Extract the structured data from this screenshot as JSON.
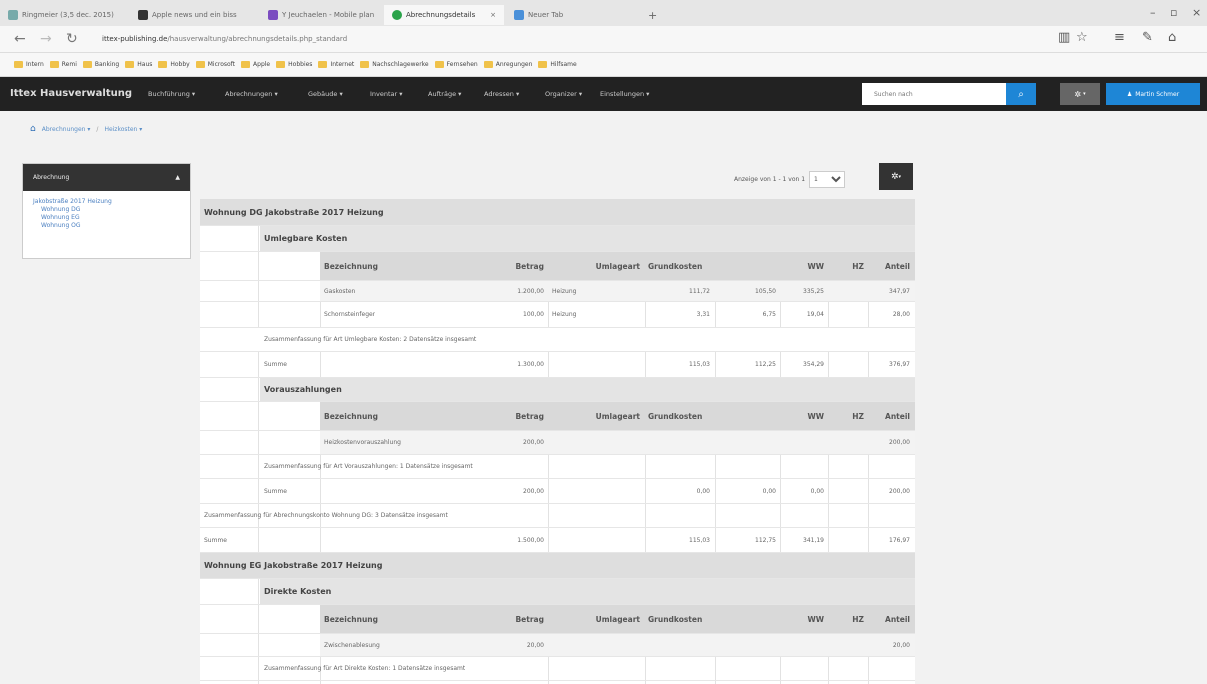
{
  "browser": {
    "tabs": [
      {
        "label": "Ringmeier (3,5 dec. 2015)",
        "active": false
      },
      {
        "label": "Apple news und ein biss",
        "active": false
      },
      {
        "label": "Y Jeuchaelen - Mobile plan",
        "active": false
      },
      {
        "label": "Abrechnungsdetails",
        "active": true
      },
      {
        "label": "Neuer Tab",
        "active": false
      }
    ],
    "url_host": "ittex-publishing.de",
    "url_path": "/hausverwaltung/abrechnungsdetails.php_standard",
    "favorites": [
      "Intern",
      "Remi",
      "Banking",
      "Haus",
      "Hobby",
      "Microsoft",
      "Apple",
      "Hobbies",
      "Internet",
      "Nachschlagewerke",
      "Fernsehen",
      "Anregungen",
      "Hilfsame"
    ]
  },
  "app": {
    "brand": "Ittex Hausverwaltung",
    "menu": [
      "Buchführung",
      "Abrechnungen",
      "Gebäude",
      "Inventar",
      "Aufträge",
      "Adressen",
      "Organizer",
      "Einstellungen"
    ],
    "search_placeholder": "Suchen nach",
    "user": "Martin Schmer"
  },
  "breadcrumb": [
    "Abrechnungen",
    "Heizkosten"
  ],
  "panel": {
    "title": "Abrechnung",
    "links": [
      "Jakobstraße 2017 Heizung",
      "Wohnung DG",
      "Wohnung EG",
      "Wohnung OG"
    ]
  },
  "pager": {
    "text": "Anzeige von 1 - 1 von 1",
    "value": "1"
  },
  "report": {
    "columns": [
      "Bezeichnung",
      "Betrag",
      "Umlageart",
      "Grundkosten",
      "WW",
      "HZ",
      "Anteil"
    ],
    "unit1": {
      "title": "Wohnung DG Jakobstraße 2017 Heizung",
      "umlegbar": {
        "title": "Umlegbare Kosten",
        "rows": [
          {
            "name": "Gaskosten",
            "betrag": "1.200,00",
            "umlage": "Heizung",
            "grund": "111,72",
            "ww": "105,50",
            "hz": "335,25",
            "anteil": "347,97"
          },
          {
            "name": "Schornsteinfeger",
            "betrag": "100,00",
            "umlage": "Heizung",
            "grund": "3,31",
            "ww": "6,75",
            "hz": "19,04",
            "anteil": "28,00"
          }
        ],
        "summary": "Zusammenfassung für Art Umlegbare Kosten: 2 Datensätze insgesamt",
        "sum_label": "Summe",
        "sum": {
          "betrag": "1.300,00",
          "grund": "115,03",
          "ww": "112,25",
          "hz": "354,29",
          "anteil": "376,97"
        }
      },
      "voraus": {
        "title": "Vorauszahlungen",
        "rows": [
          {
            "name": "Heizkostenvorauszahlung",
            "betrag": "200,00",
            "anteil": "200,00"
          }
        ],
        "summary": "Zusammenfassung für Art Vorauszahlungen: 1 Datensätze insgesamt",
        "sum_label": "Summe",
        "sum": {
          "betrag": "200,00",
          "grund": "0,00",
          "ww": "0,00",
          "hz": "0,00",
          "anteil": "200,00"
        }
      },
      "summary": "Zusammenfassung für Abrechnungskonto Wohnung DG: 3 Datensätze insgesamt",
      "sum_label": "Summe",
      "sum": {
        "betrag": "1.500,00",
        "grund": "115,03",
        "ww": "112,75",
        "hz": "341,19",
        "anteil": "176,97"
      }
    },
    "unit2": {
      "title": "Wohnung EG Jakobstraße 2017 Heizung",
      "direkt": {
        "title": "Direkte Kosten",
        "rows": [
          {
            "name": "Zwischenablesung",
            "betrag": "20,00",
            "anteil": "20,00"
          }
        ],
        "summary": "Zusammenfassung für Art Direkte Kosten: 1 Datensätze insgesamt"
      }
    }
  }
}
